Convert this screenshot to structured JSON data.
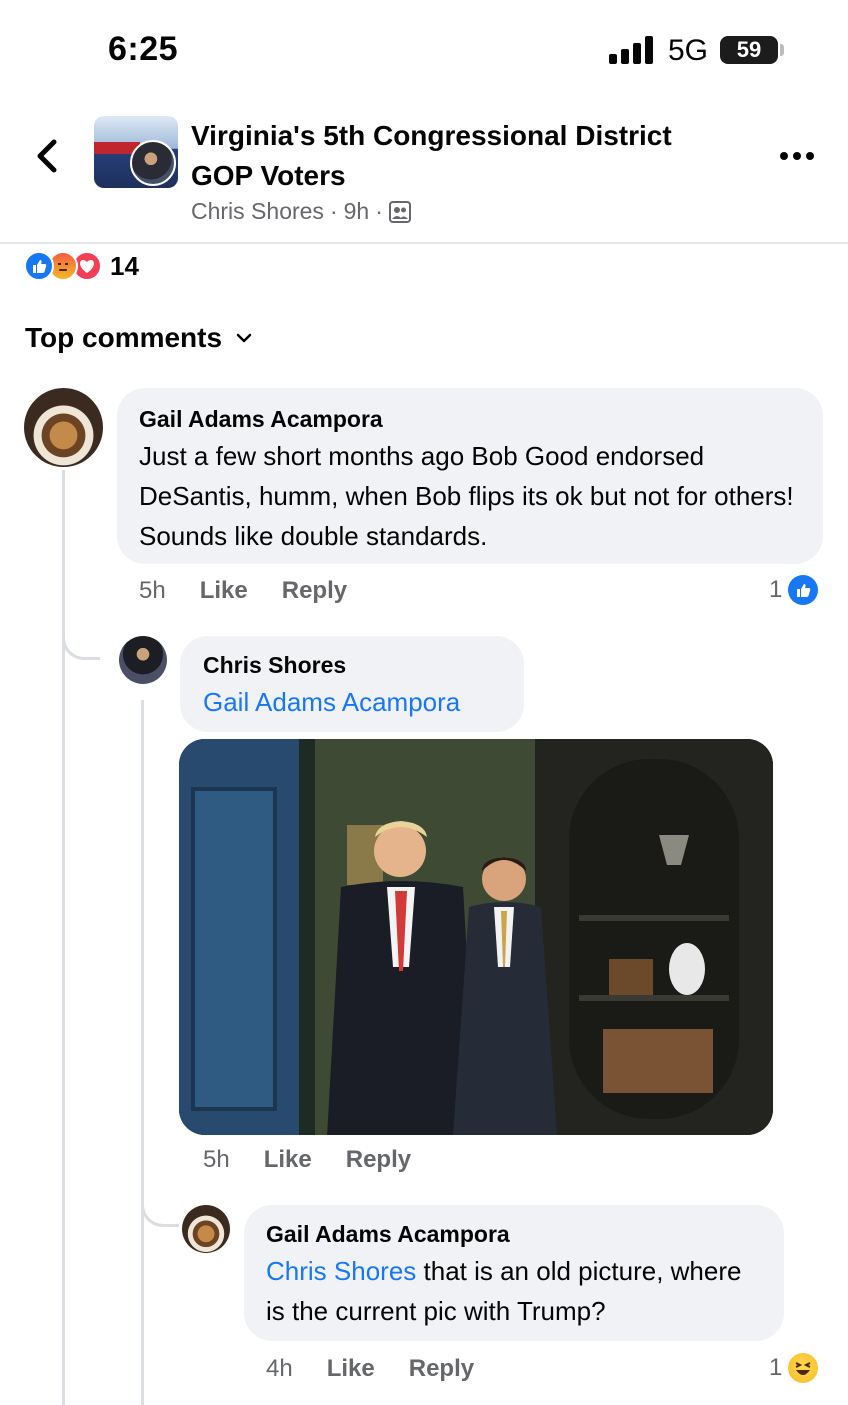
{
  "status_bar": {
    "time": "6:25",
    "network": "5G",
    "battery": "59"
  },
  "header": {
    "title_line1": "Virginia's 5th Congressional District",
    "title_line2": "GOP Voters",
    "author": "Chris Shores",
    "separator": "·",
    "post_age": "9h"
  },
  "reactions": {
    "types": [
      "like",
      "angry",
      "love"
    ],
    "count": "14"
  },
  "comments_sort": {
    "label": "Top comments"
  },
  "comments": [
    {
      "author": "Gail Adams Acampora",
      "text": "Just a few short months ago Bob Good endorsed DeSantis, humm, when Bob flips its ok but not for others! Sounds like double standards.",
      "time": "5h",
      "like_label": "Like",
      "reply_label": "Reply",
      "reaction_count": "1",
      "reaction_type": "like"
    },
    {
      "author": "Chris Shores",
      "mention": "Gail Adams Acampora",
      "text": "",
      "time": "5h",
      "like_label": "Like",
      "reply_label": "Reply",
      "has_photo": true
    },
    {
      "author": "Gail Adams Acampora",
      "mention": "Chris Shores",
      "text": " that is an old picture, where is the current pic with Trump?",
      "time": "4h",
      "like_label": "Like",
      "reply_label": "Reply",
      "reaction_count": "1",
      "reaction_type": "haha"
    }
  ],
  "colors": {
    "accent": "#1877f2",
    "bubble": "#f0f2f5",
    "muted_text": "#65676b",
    "text": "#050505"
  },
  "icons": [
    "back-arrow-icon",
    "more-icon",
    "audience-group-icon",
    "chevron-down-icon",
    "like-icon",
    "angry-icon",
    "love-icon",
    "haha-icon"
  ]
}
